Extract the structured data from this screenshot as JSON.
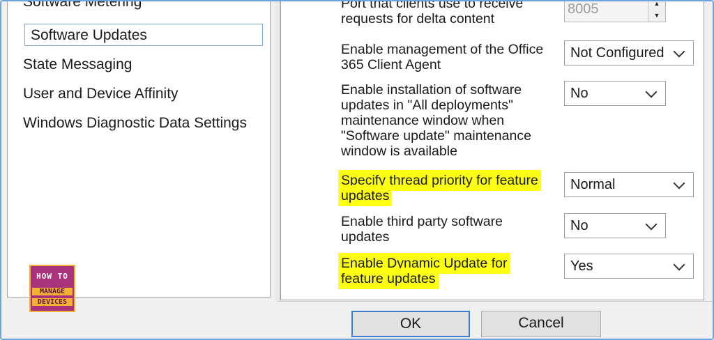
{
  "nav": {
    "items": [
      {
        "label": "Software Metering",
        "selected": false
      },
      {
        "label": "Software Updates",
        "selected": true
      },
      {
        "label": "State Messaging",
        "selected": false
      },
      {
        "label": "User and Device Affinity",
        "selected": false
      },
      {
        "label": "Windows Diagnostic Data Settings",
        "selected": false
      }
    ]
  },
  "settings": {
    "delta_port": {
      "label": "Port that clients use to receive requests for delta content",
      "value": "8005"
    },
    "office365": {
      "label": "Enable management of the Office 365 Client Agent",
      "value": "Not Configured"
    },
    "all_deployments": {
      "label": "Enable installation of software updates in \"All deployments\" maintenance window when \"Software update\" maintenance window is available",
      "value": "No"
    },
    "thread_priority": {
      "label": "Specify thread priority for feature updates",
      "value": "Normal",
      "highlighted": true
    },
    "third_party": {
      "label": "Enable third party software updates",
      "value": "No"
    },
    "dynamic_update": {
      "label": "Enable Dynamic Update for feature updates",
      "value": "Yes",
      "highlighted": true
    }
  },
  "buttons": {
    "ok": "OK",
    "cancel": "Cancel"
  },
  "logo": {
    "line1": "HOW TO",
    "line2": "MANAGE",
    "line3": "DEVICES"
  },
  "colors": {
    "highlight": "#fcff12",
    "selection_border": "#7aa7d8",
    "ok_border": "#3c7fd1",
    "frame": "#6ea3dc"
  }
}
